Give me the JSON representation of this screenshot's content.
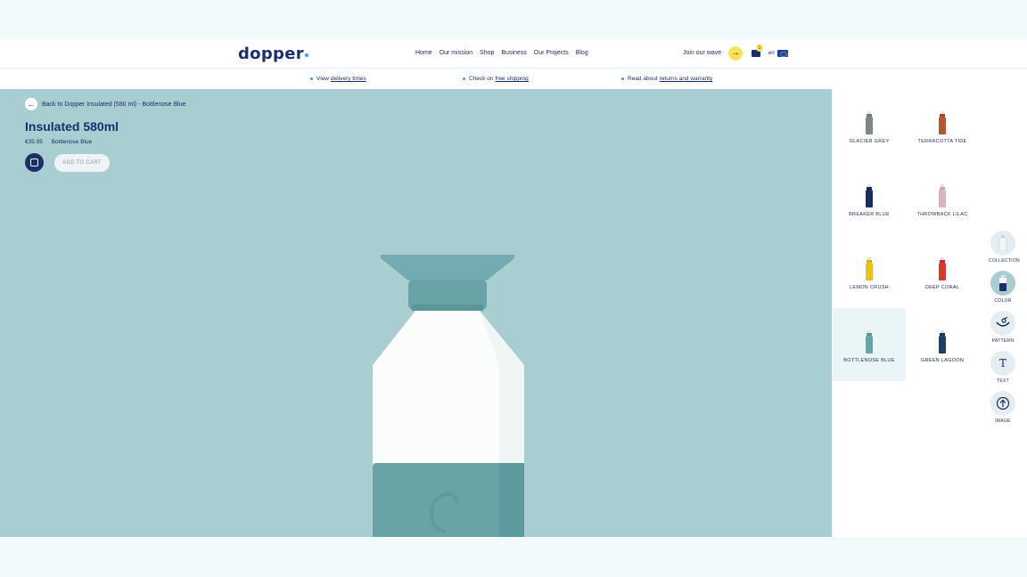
{
  "brand": {
    "name": "dopper"
  },
  "nav": [
    "Home",
    "Our mission",
    "Shop",
    "Business",
    "Our Projects",
    "Blog"
  ],
  "header": {
    "join_label": "Join our wave",
    "cart_count": "1",
    "language": "en"
  },
  "infobar": {
    "delivery": {
      "prefix": "View",
      "link": "delivery times"
    },
    "shipping": {
      "prefix": "Check on",
      "link": "free shipping"
    },
    "returns": {
      "prefix": "Read about",
      "link": "returns and warranty"
    }
  },
  "product": {
    "back_label": "Back to Dopper Insulated (580 ml) - Bottlenose Blue",
    "title": "Insulated 580ml",
    "price": "€35.95",
    "color_name": "Bottlenose Blue",
    "add_to_cart": "ADD TO CART"
  },
  "colors": [
    {
      "label": "GLACIER GREY",
      "body": "#7b8a87",
      "neck": "#6c7a78",
      "selected": false
    },
    {
      "label": "TERRACOTTA TIDE",
      "body": "#b4553a",
      "neck": "#9c4630",
      "selected": false
    },
    {
      "label": "BREAKER BLUE",
      "body": "#1c2c5c",
      "neck": "#172550",
      "selected": false
    },
    {
      "label": "THROWBACK LILAC",
      "body": "#d8b4c4",
      "neck": "#c9a2b4",
      "selected": false
    },
    {
      "label": "LEMON CRUSH",
      "body": "#e9c21f",
      "neck": "#d8ae14",
      "selected": false
    },
    {
      "label": "DEEP CORAL",
      "body": "#d33a33",
      "neck": "#bd2f2a",
      "selected": false
    },
    {
      "label": "BOTTLENOSE BLUE",
      "body": "#6aa3a6",
      "neck": "#5a9497",
      "selected": true
    },
    {
      "label": "GREEN LAGOON",
      "body": "#1f3f63",
      "neck": "#183553",
      "selected": false
    }
  ],
  "tools": [
    {
      "label": "COLLECTION",
      "icon": "bottle-icon",
      "active": false
    },
    {
      "label": "COLOR",
      "icon": "color-bottle-icon",
      "active": true
    },
    {
      "label": "PATTERN",
      "icon": "pattern-icon",
      "active": false
    },
    {
      "label": "TEXT",
      "icon": "text-icon",
      "glyph": "T",
      "active": false
    },
    {
      "label": "IMAGE",
      "icon": "upload-icon",
      "glyph": "⇧",
      "active": false
    }
  ],
  "accent": {
    "navy": "#1b2f6e",
    "yellow": "#f7e35a",
    "stage": "#a9ced2",
    "bottle_teal": "#6aa3a6"
  }
}
